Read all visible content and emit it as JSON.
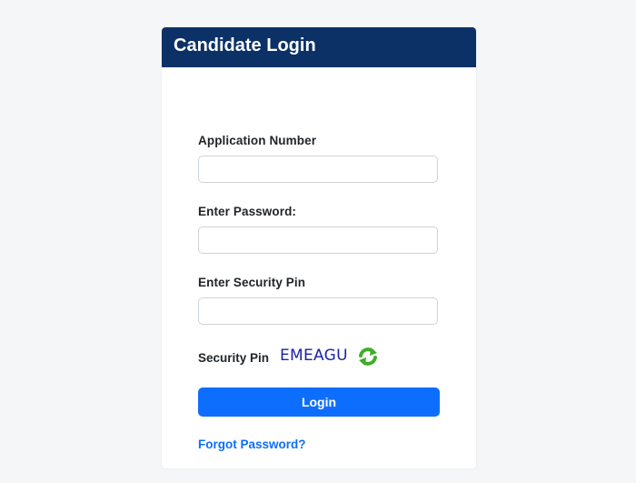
{
  "header": {
    "title": "Candidate Login"
  },
  "form": {
    "application_number": {
      "label": "Application Number",
      "value": "",
      "placeholder": ""
    },
    "password": {
      "label": "Enter Password:",
      "value": "",
      "placeholder": ""
    },
    "security_pin_input": {
      "label": "Enter Security Pin",
      "value": "",
      "placeholder": ""
    },
    "security_pin": {
      "label": "Security Pin",
      "code": "EMEAGU",
      "refresh_icon": "refresh-icon"
    },
    "login_label": "Login",
    "forgot_password_label": "Forgot Password?"
  },
  "colors": {
    "header_bg": "#0c3166",
    "primary": "#0d6efd",
    "captcha_text": "#1a23a8",
    "refresh_green": "#3fae29"
  }
}
